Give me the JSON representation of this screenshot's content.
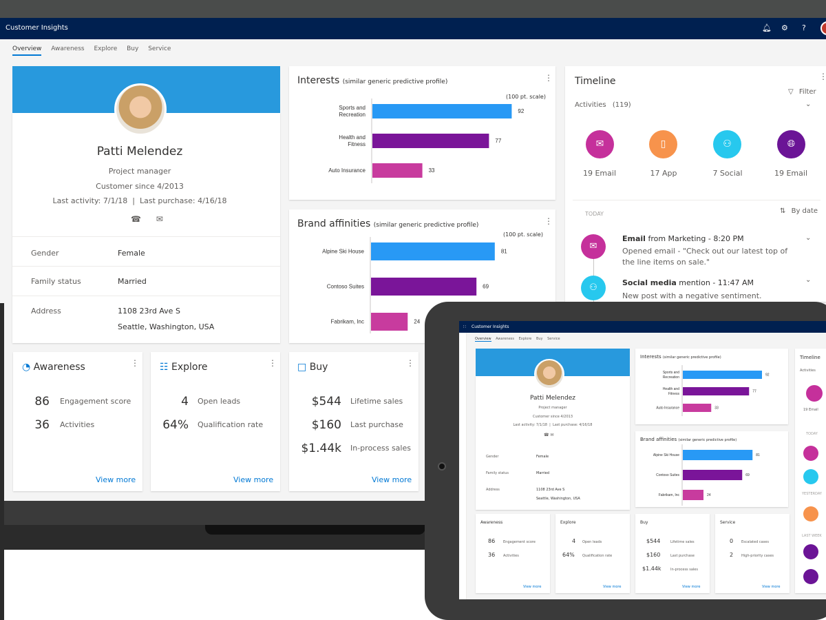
{
  "app": {
    "title": "Customer Insights"
  },
  "topbar": {
    "notifications_icon": "bell-icon",
    "settings_icon": "gear-icon",
    "help_label": "?"
  },
  "tabs": [
    "Overview",
    "Awareness",
    "Explore",
    "Buy",
    "Service"
  ],
  "profile": {
    "name": "Patti Melendez",
    "role": "Project manager",
    "customer_since": "Customer since 4/2013",
    "activity": "Last activity: 7/1/18  |  Last purchase: 4/16/18",
    "fields": [
      {
        "label": "Gender",
        "value": "Female"
      },
      {
        "label": "Family status",
        "value": "Married"
      },
      {
        "label": "Address",
        "value": "1108 23rd Ave S",
        "value2": "Seattle, Washington, USA"
      }
    ]
  },
  "interests": {
    "title": "Interests",
    "subtitle": "(similar generic predictive profile)",
    "scale": "(100 pt. scale)",
    "bars": [
      {
        "label": "Sports and",
        "label2": "Recreation",
        "value": 92,
        "color": "#2899f5"
      },
      {
        "label": "Health and",
        "label2": "Fitness",
        "value": 77,
        "color": "#7a1599"
      },
      {
        "label": "Auto Insurance",
        "label2": "",
        "value": 33,
        "color": "#c83b9e"
      }
    ]
  },
  "brands": {
    "title": "Brand affinities",
    "subtitle": "(similar generic predictive profile)",
    "scale": "(100 pt. scale)",
    "bars": [
      {
        "label": "Alpine Ski House",
        "value": 81,
        "color": "#2899f5"
      },
      {
        "label": "Contoso Suites",
        "value": 69,
        "color": "#7a1599"
      },
      {
        "label": "Fabrikam, Inc",
        "value": 24,
        "color": "#c83b9e"
      }
    ]
  },
  "timeline": {
    "title": "Timeline",
    "filter": "Filter",
    "activities_label": "Activities",
    "activities_count": "(119)",
    "summary": [
      {
        "label": "19 Email",
        "color": "#c5309b",
        "icon": "mail-icon"
      },
      {
        "label": "17 App",
        "color": "#f7934c",
        "icon": "phone-app-icon"
      },
      {
        "label": "7 Social",
        "color": "#27c8ee",
        "icon": "people-icon"
      },
      {
        "label": "19 Email",
        "color": "#6b1496",
        "icon": "globe-icon"
      }
    ],
    "today": "TODAY",
    "sort": "By date",
    "items": [
      {
        "title_bold": "Email",
        "title_rest": " from Marketing - 8:20 PM",
        "line1": "Opened  email - \"Check out our latest top of",
        "line2": "the line items on sale.\"",
        "color": "#c5309b"
      },
      {
        "title_bold": "Social media",
        "title_rest": " mention - 11:47 AM",
        "line1": "New post with a negative sentiment.",
        "line2": "",
        "color": "#27c8ee"
      }
    ]
  },
  "metrics": {
    "awareness": {
      "title": "Awareness",
      "rows": [
        {
          "value": "86",
          "label": "Engagement score"
        },
        {
          "value": "36",
          "label": "Activities"
        }
      ],
      "link": "View more"
    },
    "explore": {
      "title": "Explore",
      "rows": [
        {
          "value": "4",
          "label": "Open leads"
        },
        {
          "value": "64%",
          "label": "Qualification rate"
        }
      ],
      "link": "View more"
    },
    "buy": {
      "title": "Buy",
      "rows": [
        {
          "value": "$544",
          "label": "Lifetime sales"
        },
        {
          "value": "$160",
          "label": "Last purchase"
        },
        {
          "value": "$1.44k",
          "label": "In-process sales"
        }
      ],
      "link": "View more"
    }
  },
  "tablet": {
    "service": {
      "title": "Service",
      "rows": [
        {
          "value": "0",
          "label": "Escalated cases"
        },
        {
          "value": "2",
          "label": "High-priority cases"
        }
      ],
      "link": "View more"
    },
    "timeline_sections": [
      "TODAY",
      "YESTERDAY",
      "LAST WEEK"
    ],
    "timeline_count": "19 Email"
  }
}
